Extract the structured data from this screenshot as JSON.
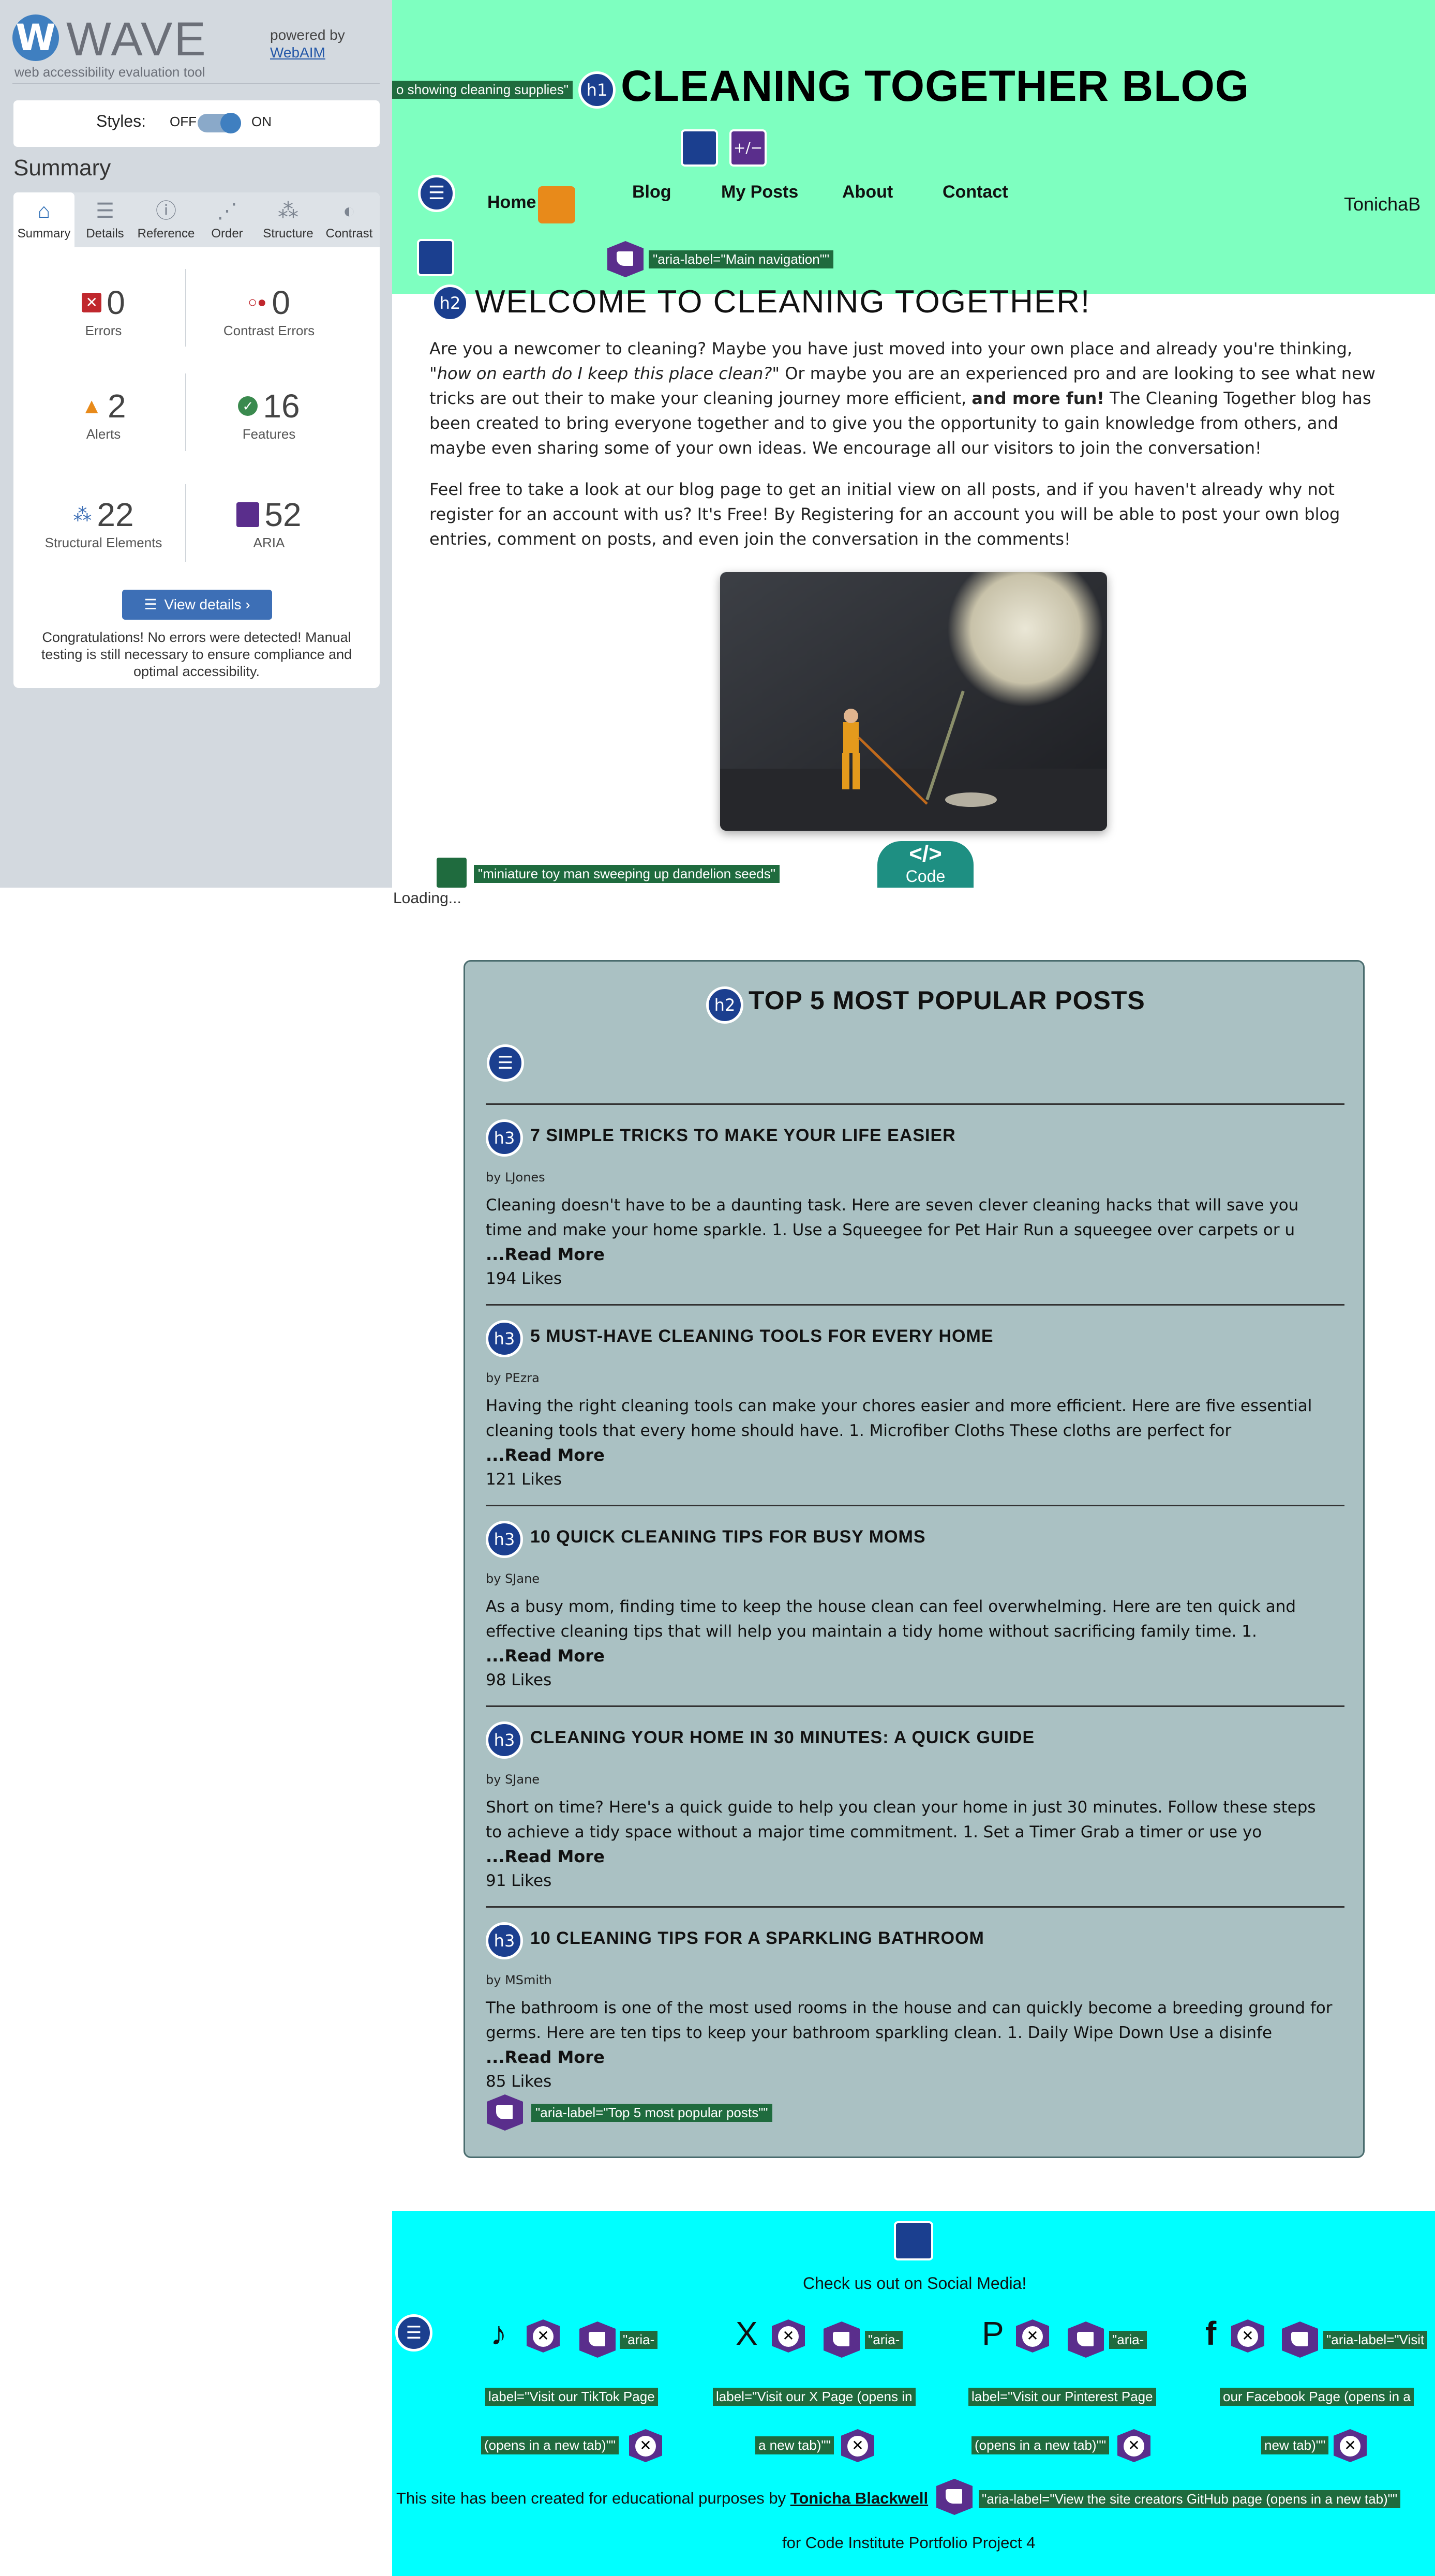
{
  "wave": {
    "logo_letter": "W",
    "brand": "WAVE",
    "subtitle": "web accessibility evaluation tool",
    "powered_by": "powered by",
    "webaim": "WebAIM",
    "styles_label": "Styles:",
    "off": "OFF",
    "on": "ON",
    "summary_heading": "Summary",
    "tabs": [
      {
        "label": "Summary",
        "icon": "home-icon"
      },
      {
        "label": "Details",
        "icon": "list-icon"
      },
      {
        "label": "Reference",
        "icon": "info-icon"
      },
      {
        "label": "Order",
        "icon": "order-icon"
      },
      {
        "label": "Structure",
        "icon": "structure-icon"
      },
      {
        "label": "Contrast",
        "icon": "contrast-icon"
      }
    ],
    "stats": {
      "errors": {
        "value": "0",
        "label": "Errors"
      },
      "contrast": {
        "value": "0",
        "label": "Contrast Errors"
      },
      "alerts": {
        "value": "2",
        "label": "Alerts"
      },
      "features": {
        "value": "16",
        "label": "Features"
      },
      "structural": {
        "value": "22",
        "label": "Structural Elements"
      },
      "aria": {
        "value": "52",
        "label": "ARIA"
      }
    },
    "view_details": "View details ›",
    "congrats": "Congratulations! No errors were detected! Manual testing is still necessary to ensure compliance and optimal accessibility.",
    "colors": {
      "error": "#c0272d",
      "alert": "#e88a1a",
      "feature": "#3a8a4e",
      "brand": "#3f7fc0"
    }
  },
  "site": {
    "alt_tag_top": "o showing cleaning supplies\"",
    "h1_badge": "h1",
    "title": "CLEANING TOGETHER BLOG",
    "nav": [
      "Home",
      "Blog",
      "My Posts",
      "About",
      "Contact"
    ],
    "user": "TonichaB",
    "nav_aria": "\"aria-label=\"Main navigation\"\"",
    "h2_badge": "h2",
    "welcome": "WELCOME TO CLEANING TOGETHER!",
    "intro_1": "Are you a newcomer to cleaning? Maybe you have just moved into your own place and already you're thinking, ",
    "intro_1_em": "\"how on earth do I keep this place clean?\"",
    "intro_1b": " Or maybe you are an experienced pro and are looking to see what new tricks are out their to make your cleaning journey more efficient, ",
    "intro_1_strong": "and more fun!",
    "intro_1c": " The Cleaning Together blog has been created to bring everyone together and to give you the opportunity to gain knowledge from others, and maybe even sharing some of your own ideas. We encourage all our visitors to join the conversation!",
    "intro_2": "Feel free to take a look at our blog page to get an initial view on all posts, and if you haven't already why not register for an account with us? It's Free! By Registering for an account you will be able to post your own blog entries, comment on posts, and even join the conversation in the comments!",
    "image_alt_tag": "\"miniature toy man sweeping up dandelion seeds\"",
    "code_label": "Code",
    "code_glyph": "</>",
    "loading": "Loading..."
  },
  "popular": {
    "h2_badge": "h2",
    "title": "TOP 5 MOST POPULAR POSTS",
    "h3_badge": "h3",
    "read_more": "...Read More",
    "aria_tag": "\"aria-label=\"Top 5 most popular posts\"\"",
    "posts": [
      {
        "title": "7 SIMPLE TRICKS TO MAKE YOUR LIFE EASIER",
        "by": "by LJones",
        "excerpt": "Cleaning doesn't have to be a daunting task. Here are seven clever cleaning hacks that will save you time and make your home sparkle. 1. Use a Squeegee for Pet Hair Run a squeegee over carpets or u",
        "likes": "194 Likes"
      },
      {
        "title": "5 MUST-HAVE CLEANING TOOLS FOR EVERY HOME",
        "by": "by PEzra",
        "excerpt": "Having the right cleaning tools can make your chores easier and more efficient. Here are five essential cleaning tools that every home should have. 1. Microfiber Cloths These cloths are perfect for",
        "likes": "121 Likes"
      },
      {
        "title": "10 QUICK CLEANING TIPS FOR BUSY MOMS",
        "by": "by SJane",
        "excerpt": "As a busy mom, finding time to keep the house clean can feel overwhelming. Here are ten quick and effective cleaning tips that will help you maintain a tidy home without sacrificing family time. 1.",
        "likes": "98 Likes"
      },
      {
        "title": "CLEANING YOUR HOME IN 30 MINUTES: A QUICK GUIDE",
        "by": "by SJane",
        "excerpt": "Short on time? Here's a quick guide to help you clean your home in just 30 minutes. Follow these steps to achieve a tidy space without a major time commitment. 1. Set a Timer Grab a timer or use yo",
        "likes": "91 Likes"
      },
      {
        "title": "10 CLEANING TIPS FOR A SPARKLING BATHROOM",
        "by": "by MSmith",
        "excerpt": "The bathroom is one of the most used rooms in the house and can quickly become a breeding ground for germs. Here are ten tips to keep your bathroom sparkling clean. 1. Daily Wipe Down Use a disinfe",
        "likes": "85 Likes"
      }
    ]
  },
  "footer": {
    "social_heading": "Check us out on Social Media!",
    "socials": [
      {
        "icon": "tiktok-icon",
        "glyph": "♪",
        "l1": "\"aria-",
        "l2": "label=\"Visit our TikTok Page",
        "l3": "(opens in a new tab)\"\""
      },
      {
        "icon": "x-icon",
        "glyph": "X",
        "l1": "\"aria-",
        "l2": "label=\"Visit our X Page (opens in",
        "l3": "a new tab)\"\""
      },
      {
        "icon": "pinterest-icon",
        "glyph": "P",
        "l1": "\"aria-",
        "l2": "label=\"Visit our Pinterest Page",
        "l3": "(opens in a new tab)\"\""
      },
      {
        "icon": "facebook-icon",
        "glyph": "f",
        "l1": "\"aria-label=\"Visit",
        "l2": "our Facebook Page (opens in a",
        "l3": "new tab)\"\""
      }
    ],
    "created_prefix": "This site has been created for educational purposes by ",
    "author": "Tonicha Blackwell",
    "github_aria": "\"aria-label=\"View the site creators GitHub page (opens in a new tab)\"\"",
    "portfolio": "for Code Institute Portfolio Project 4",
    "bg": "#00ffff"
  }
}
